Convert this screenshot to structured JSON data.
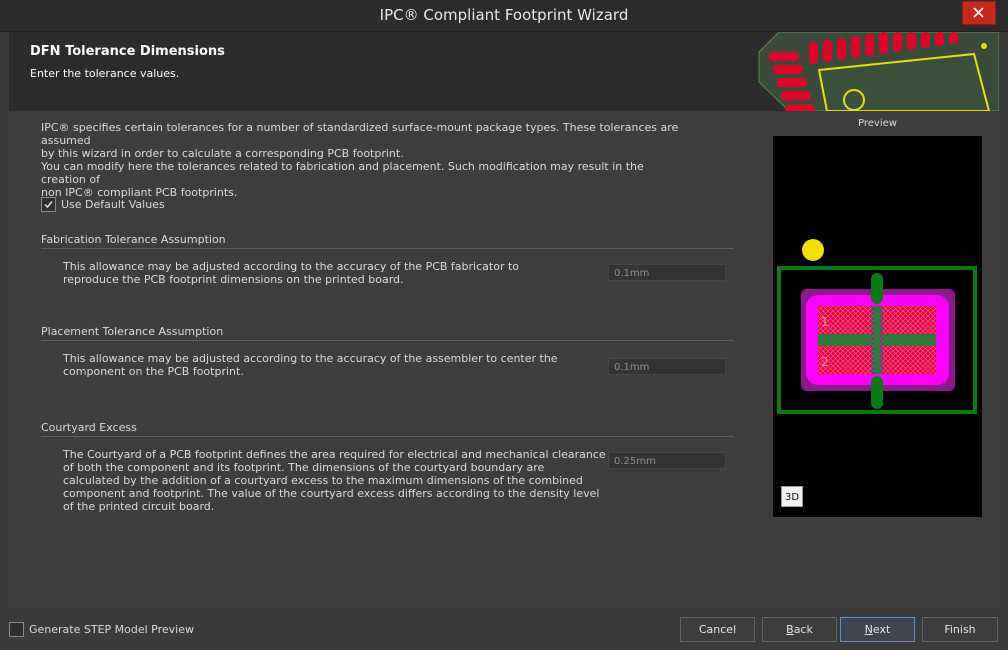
{
  "window": {
    "title": "IPC® Compliant Footprint Wizard"
  },
  "header": {
    "title": "DFN Tolerance Dimensions",
    "subtitle": "Enter the tolerance values."
  },
  "intro": {
    "line1": "IPC® specifies certain tolerances for a number of standardized surface-mount package types. These tolerances are assumed",
    "line2": "by this wizard in order to calculate a corresponding PCB footprint.",
    "line3": "You can modify here the tolerances related to fabrication and placement. Such modification may result in the creation of",
    "line4": "non IPC® compliant PCB footprints."
  },
  "defaults_checkbox": {
    "label": "Use Default Values",
    "checked": true
  },
  "fabrication": {
    "title": "Fabrication Tolerance Assumption",
    "desc1": "This allowance may be adjusted according to the accuracy of the PCB fabricator to",
    "desc2": "reproduce the PCB footprint dimensions on the printed board.",
    "value": "0.1mm"
  },
  "placement": {
    "title": "Placement Tolerance Assumption",
    "desc1": "This allowance may be adjusted according to the accuracy of the assembler to center the",
    "desc2": "component on the PCB footprint.",
    "value": "0.1mm"
  },
  "courtyard": {
    "title": "Courtyard Excess",
    "desc1": "The Courtyard of a PCB footprint defines the area required for electrical and mechanical clearance",
    "desc2": "of both the component and its footprint. The dimensions of the courtyard boundary are",
    "desc3": "calculated by the addition of a courtyard excess to the maximum dimensions of the combined",
    "desc4": "component and footprint. The value of the courtyard excess differs according to the density level",
    "desc5": "of the printed circuit board.",
    "value": "0.25mm"
  },
  "preview": {
    "label": "Preview",
    "pad1": "1",
    "pad2": "2",
    "btn3d": "3D",
    "colors": {
      "background": "#000000",
      "outline": "#0b7a16",
      "body": "#ff00ff",
      "pad": "#ff0000",
      "pin1": "#f0e000"
    }
  },
  "footer": {
    "step_checkbox": {
      "label": "Generate STEP Model Preview",
      "checked": false
    },
    "cancel": "Cancel",
    "back_pre": "",
    "back_key": "B",
    "back_post": "ack",
    "next_pre": "",
    "next_key": "N",
    "next_post": "ext",
    "finish": "Finish"
  }
}
